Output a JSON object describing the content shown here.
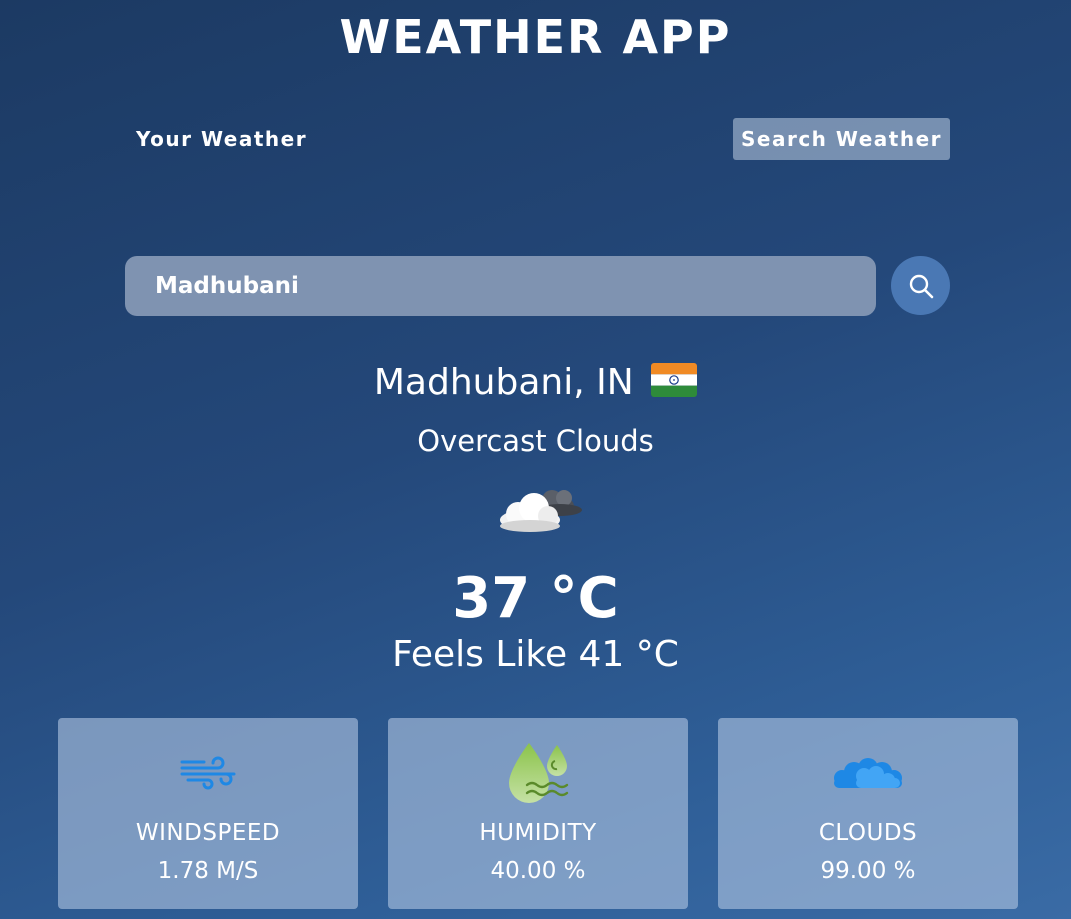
{
  "app": {
    "title": "WEATHER APP"
  },
  "tabs": [
    {
      "label": "Your Weather",
      "active": false
    },
    {
      "label": "Search Weather",
      "active": true
    }
  ],
  "search": {
    "value": "Madhubani",
    "icon": "search-icon"
  },
  "weather": {
    "location": "Madhubani, IN",
    "flag": "india-flag-icon",
    "description": "Overcast Clouds",
    "icon": "overcast-clouds-icon",
    "temperature": "37 °C",
    "feels_like": "Feels Like 41 °C"
  },
  "stats": [
    {
      "label": "WINDSPEED",
      "value": "1.78 M/S",
      "icon": "wind-icon"
    },
    {
      "label": "HUMIDITY",
      "value": "40.00 %",
      "icon": "humidity-icon"
    },
    {
      "label": "CLOUDS",
      "value": "99.00 %",
      "icon": "clouds-icon"
    }
  ],
  "colors": {
    "accent": "#4a78b4",
    "wind_icon": "#1e88e5",
    "humidity_icon": "#9ccc65",
    "clouds_icon": "#1e88e5"
  }
}
